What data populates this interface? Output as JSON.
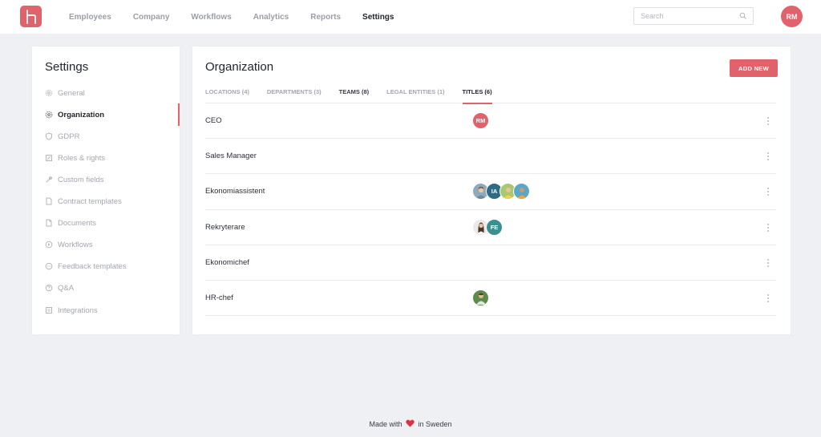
{
  "nav": {
    "items": [
      {
        "label": "Employees",
        "active": false
      },
      {
        "label": "Company",
        "active": false
      },
      {
        "label": "Workflows",
        "active": false
      },
      {
        "label": "Analytics",
        "active": false
      },
      {
        "label": "Reports",
        "active": false
      },
      {
        "label": "Settings",
        "active": true
      }
    ],
    "search_placeholder": "Search",
    "user_initials": "RM"
  },
  "sidebar": {
    "title": "Settings",
    "items": [
      {
        "label": "General",
        "icon": "gear-icon"
      },
      {
        "label": "Organization",
        "icon": "organization-icon",
        "active": true
      },
      {
        "label": "GDPR",
        "icon": "shield-icon"
      },
      {
        "label": "Roles & rights",
        "icon": "roles-icon"
      },
      {
        "label": "Custom fields",
        "icon": "wrench-icon"
      },
      {
        "label": "Contract templates",
        "icon": "document-icon"
      },
      {
        "label": "Documents",
        "icon": "file-icon"
      },
      {
        "label": "Workflows",
        "icon": "play-circle-icon"
      },
      {
        "label": "Feedback templates",
        "icon": "chat-icon"
      },
      {
        "label": "Q&A",
        "icon": "question-icon"
      },
      {
        "label": "Integrations",
        "icon": "list-icon"
      }
    ]
  },
  "main": {
    "title": "Organization",
    "add_button": "ADD NEW",
    "tabs": [
      {
        "label": "LOCATIONS (4)"
      },
      {
        "label": "DEPARTMENTS (3)"
      },
      {
        "label": "TEAMS (8)"
      },
      {
        "label": "LEGAL ENTITIES (1)"
      },
      {
        "label": "TITLES (6)",
        "active": true
      }
    ],
    "rows": [
      {
        "title": "CEO",
        "avatars": [
          {
            "initials": "RM",
            "color": "#e0626b"
          }
        ]
      },
      {
        "title": "Sales Manager",
        "avatars": []
      },
      {
        "title": "Ekonomiassistent",
        "avatars": [
          {
            "initials": "",
            "color": "#8fa9bd"
          },
          {
            "initials": "IA",
            "color": "#2f6b84"
          },
          {
            "initials": "",
            "color": "#a9c96e"
          },
          {
            "initials": "",
            "color": "#f0a43a"
          }
        ]
      },
      {
        "title": "Rekryterare",
        "avatars": [
          {
            "initials": "",
            "color": "#d9d4d1"
          },
          {
            "initials": "FE",
            "color": "#3b8f8f"
          }
        ]
      },
      {
        "title": "Ekonomichef",
        "avatars": []
      },
      {
        "title": "HR-chef",
        "avatars": [
          {
            "initials": "",
            "color": "#5d8c4a"
          }
        ]
      }
    ]
  },
  "footer": {
    "before": "Made with",
    "after": "in Sweden"
  },
  "colors": {
    "accent": "#e0626b",
    "background": "#eef0f4"
  }
}
